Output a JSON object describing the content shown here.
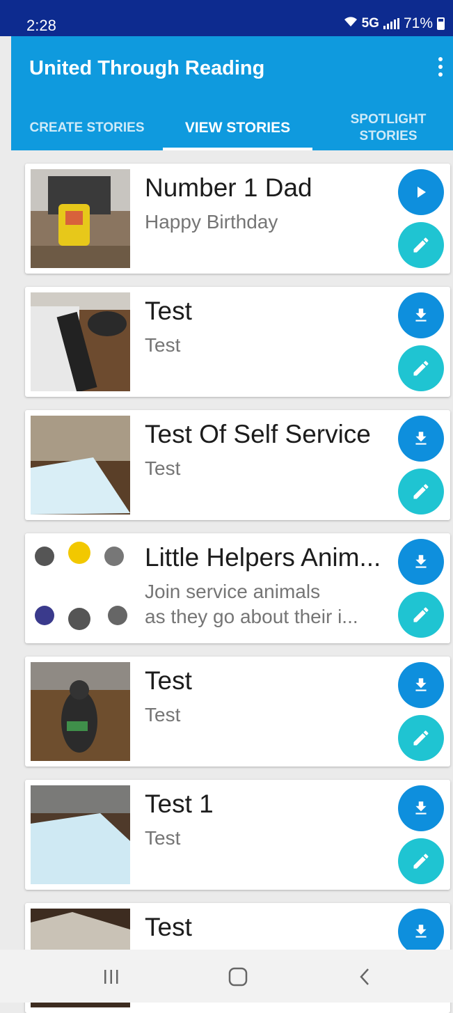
{
  "status_bar": {
    "time": "2:28",
    "network": "5G",
    "battery": "71%"
  },
  "app": {
    "title": "United Through Reading"
  },
  "tabs": [
    {
      "label": "CREATE STORIES"
    },
    {
      "label": "VIEW STORIES"
    },
    {
      "label_line1": "SPOTLIGHT",
      "label_line2": "STORIES"
    }
  ],
  "stories": [
    {
      "title": "Number 1 Dad",
      "subtitle": "Happy Birthday",
      "action": "play-icon"
    },
    {
      "title": "Test",
      "subtitle": "Test",
      "action": "download-icon"
    },
    {
      "title": "Test Of Self Service",
      "subtitle": "Test",
      "action": "download-icon"
    },
    {
      "title": "Little Helpers Anim...",
      "subtitle_line1": "Join service animals",
      "subtitle_line2": "as they go about their i...",
      "action": "download-icon"
    },
    {
      "title": "Test",
      "subtitle": "Test",
      "action": "download-icon"
    },
    {
      "title": "Test 1",
      "subtitle": "Test",
      "action": "download-icon"
    },
    {
      "title": "Test",
      "action": "download-icon"
    }
  ],
  "colors": {
    "status_bar": "#0d2b8f",
    "app_bar": "#0f9ade",
    "primary_fab": "#0e8fdd",
    "edit_fab": "#1fc4d2"
  },
  "nav_bar": {
    "buttons": [
      "recent-apps-icon",
      "home-icon",
      "back-icon"
    ]
  }
}
